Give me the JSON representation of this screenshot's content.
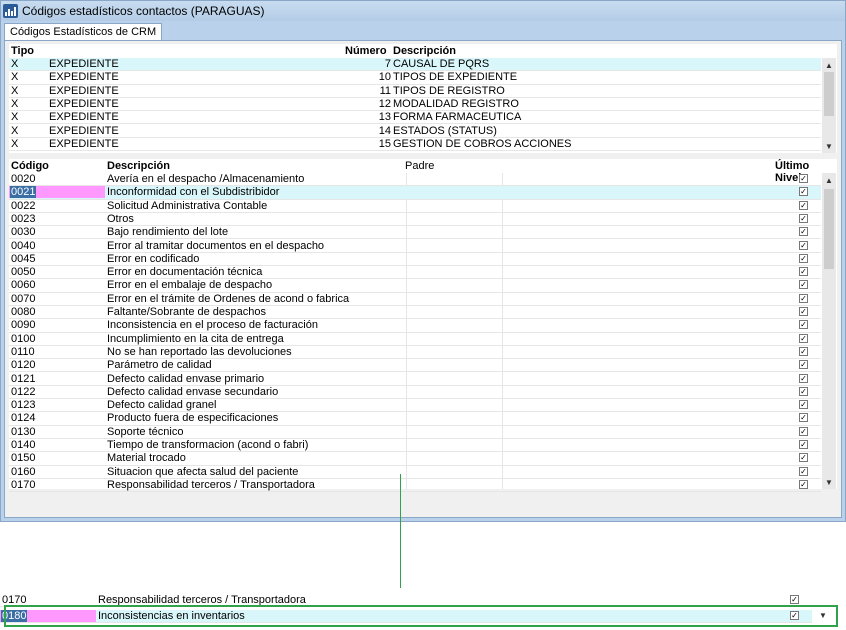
{
  "window": {
    "title": "Códigos estadísticos contactos (PARAGUAS)"
  },
  "tab": {
    "label": "Códigos Estadísticos de CRM"
  },
  "top_grid": {
    "headers": {
      "tipo": "Tipo",
      "numero": "Número",
      "descripcion": "Descripción"
    },
    "rows": [
      {
        "x": "X",
        "tipo": "EXPEDIENTE",
        "numero": "7",
        "descripcion": "CAUSAL DE PQRS"
      },
      {
        "x": "X",
        "tipo": "EXPEDIENTE",
        "numero": "10",
        "descripcion": "TIPOS DE EXPEDIENTE"
      },
      {
        "x": "X",
        "tipo": "EXPEDIENTE",
        "numero": "11",
        "descripcion": "TIPOS DE REGISTRO"
      },
      {
        "x": "X",
        "tipo": "EXPEDIENTE",
        "numero": "12",
        "descripcion": "MODALIDAD REGISTRO"
      },
      {
        "x": "X",
        "tipo": "EXPEDIENTE",
        "numero": "13",
        "descripcion": "FORMA FARMACEUTICA"
      },
      {
        "x": "X",
        "tipo": "EXPEDIENTE",
        "numero": "14",
        "descripcion": "ESTADOS (STATUS)"
      },
      {
        "x": "X",
        "tipo": "EXPEDIENTE",
        "numero": "15",
        "descripcion": "GESTION DE COBROS ACCIONES"
      }
    ]
  },
  "bottom_grid": {
    "headers": {
      "codigo": "Código",
      "descripcion": "Descripción",
      "padre": "Padre",
      "ultimo": "Último Nivel"
    },
    "rows": [
      {
        "codigo": "0020",
        "descripcion": "Avería en el despacho /Almacenamiento"
      },
      {
        "codigo": "0021",
        "descripcion": "Inconformidad con el Subdistribidor"
      },
      {
        "codigo": "0022",
        "descripcion": "Solicitud Administrativa Contable"
      },
      {
        "codigo": "0023",
        "descripcion": "Otros"
      },
      {
        "codigo": "0030",
        "descripcion": "Bajo rendimiento del lote"
      },
      {
        "codigo": "0040",
        "descripcion": "Error al tramitar documentos en el despacho"
      },
      {
        "codigo": "0045",
        "descripcion": "Error en codificado"
      },
      {
        "codigo": "0050",
        "descripcion": "Error en documentación técnica"
      },
      {
        "codigo": "0060",
        "descripcion": "Error en el embalaje de despacho"
      },
      {
        "codigo": "0070",
        "descripcion": "Error en el trámite de Ordenes de acond o fabrica"
      },
      {
        "codigo": "0080",
        "descripcion": "Faltante/Sobrante de despachos"
      },
      {
        "codigo": "0090",
        "descripcion": "Inconsistencia en el proceso de facturación"
      },
      {
        "codigo": "0100",
        "descripcion": "Incumplimiento en la cita de entrega"
      },
      {
        "codigo": "0110",
        "descripcion": "No se han reportado las devoluciones"
      },
      {
        "codigo": "0120",
        "descripcion": "Parámetro de calidad"
      },
      {
        "codigo": "0121",
        "descripcion": "Defecto calidad envase primario"
      },
      {
        "codigo": "0122",
        "descripcion": "Defecto calidad envase secundario"
      },
      {
        "codigo": "0123",
        "descripcion": "Defecto calidad granel"
      },
      {
        "codigo": "0124",
        "descripcion": "Producto fuera de especificaciones"
      },
      {
        "codigo": "0130",
        "descripcion": "Soporte técnico"
      },
      {
        "codigo": "0140",
        "descripcion": "Tiempo de transformacion (acond o fabri)"
      },
      {
        "codigo": "0150",
        "descripcion": "Material trocado"
      },
      {
        "codigo": "0160",
        "descripcion": "Situacion que afecta salud del paciente"
      },
      {
        "codigo": "0170",
        "descripcion": "Responsabilidad terceros / Transportadora"
      }
    ]
  },
  "zoom_rows": [
    {
      "codigo": "0170",
      "descripcion": "Responsabilidad terceros / Transportadora"
    },
    {
      "codigo": "0180",
      "descripcion": "Inconsistencias en inventarios"
    }
  ],
  "colors": {
    "selected_row": "#d9f6fa",
    "selected_code": "#ff99ff",
    "annotation": "#2fa24b"
  },
  "icons": {
    "check": "✓",
    "up": "▲",
    "down": "▼"
  }
}
